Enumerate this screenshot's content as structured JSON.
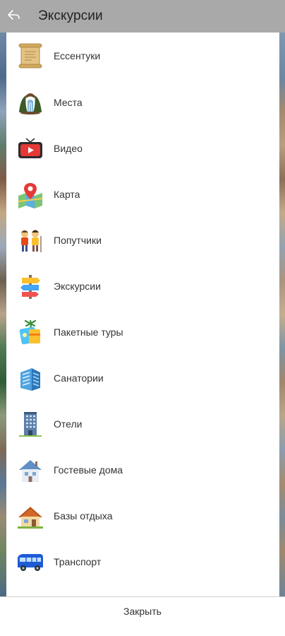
{
  "header": {
    "title": "Экскурсии",
    "back_icon": "back-arrow-icon",
    "background_color": "#a9a9a9"
  },
  "menu": {
    "items": [
      {
        "label": "Ессентуки",
        "icon": "scroll-icon"
      },
      {
        "label": "Места",
        "icon": "landmark-icon"
      },
      {
        "label": "Видео",
        "icon": "video-player-icon"
      },
      {
        "label": "Карта",
        "icon": "map-pin-icon"
      },
      {
        "label": "Попутчики",
        "icon": "travelers-icon"
      },
      {
        "label": "Экскурсии",
        "icon": "signpost-icon"
      },
      {
        "label": "Пакетные туры",
        "icon": "package-tour-icon"
      },
      {
        "label": "Санатории",
        "icon": "sanatorium-building-icon"
      },
      {
        "label": "Отели",
        "icon": "hotel-building-icon"
      },
      {
        "label": "Гостевые дома",
        "icon": "guest-house-icon"
      },
      {
        "label": "Базы отдыха",
        "icon": "cottage-icon"
      },
      {
        "label": "Транспорт",
        "icon": "bus-icon"
      }
    ]
  },
  "footer": {
    "close_label": "Закрыть"
  }
}
